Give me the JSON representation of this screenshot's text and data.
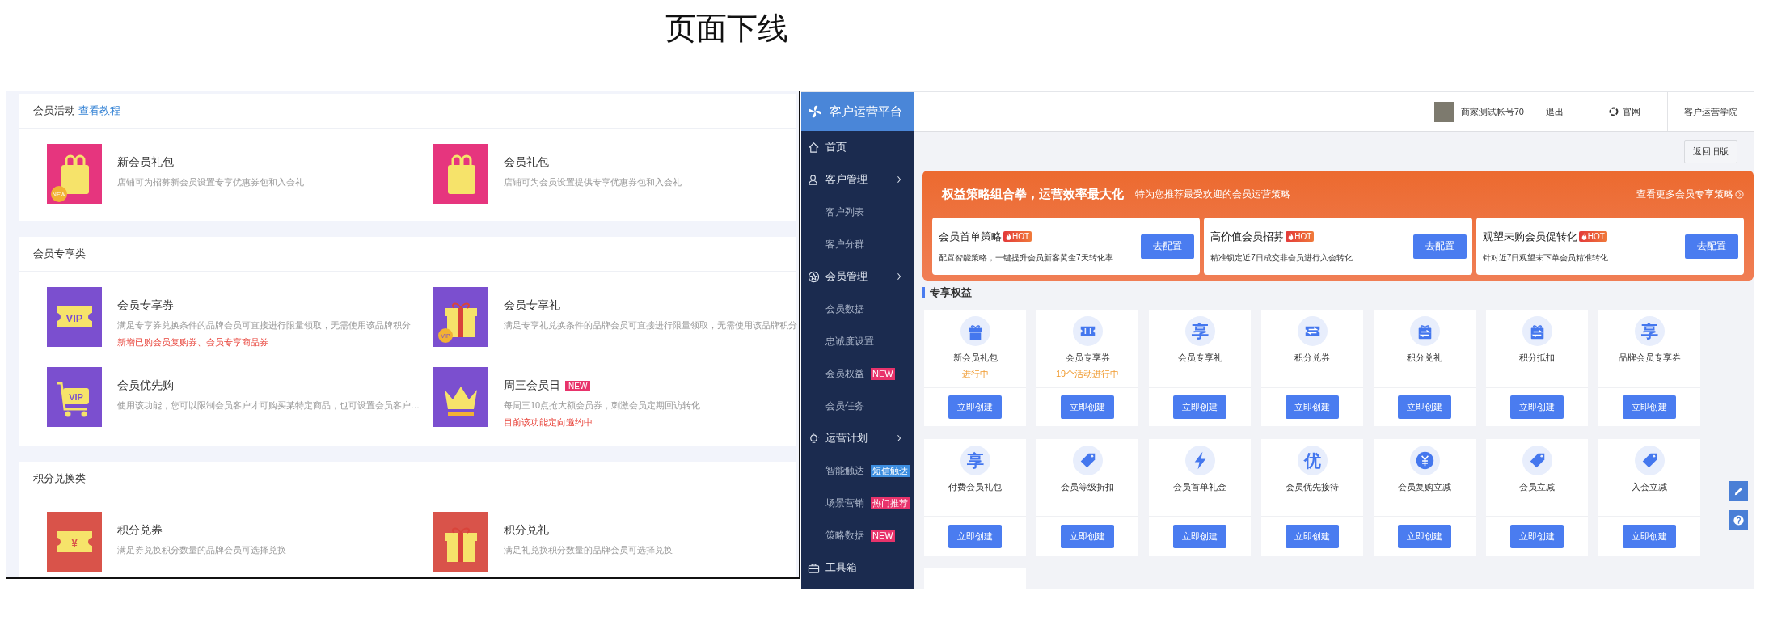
{
  "page_title": "页面下线",
  "old_page": {
    "sections": [
      {
        "title": "会员活动",
        "link": "查看教程",
        "color": "#e6357e",
        "items": [
          {
            "title": "新会员礼包",
            "desc": "店铺可为招募新会员设置专享优惠券包和入会礼",
            "kind": "bag",
            "icon_text": "NEW"
          },
          {
            "title": "会员礼包",
            "desc": "店铺可为会员设置提供专享优惠券包和入会礼",
            "kind": "bag"
          }
        ]
      },
      {
        "title": "会员专享类",
        "color": "#7b4fcf",
        "items": [
          {
            "title": "会员专享券",
            "desc": "满足专享券兑换条件的品牌会员可直接进行限量领取，无需使用该品牌积分",
            "note": "新增已购会员复购券、会员专享商品券",
            "kind": "ticket",
            "icon_text": "VIP"
          },
          {
            "title": "会员专享礼",
            "desc": "满足专享礼兑换条件的品牌会员可直接进行限量领取，无需使用该品牌积分",
            "kind": "gift",
            "icon_text": "VIP"
          },
          {
            "title": "会员优先购",
            "desc": "使用该功能，您可以限制会员客户才可购买某特定商品，也可设置会员客户…",
            "kind": "cart",
            "icon_text": "VIP"
          },
          {
            "title": "周三会员日",
            "badge": "NEW",
            "desc": "每周三10点抢大额会员券，刺激会员定期回访转化",
            "note": "目前该功能定向邀约中",
            "kind": "crown"
          }
        ]
      },
      {
        "title": "积分兑换类",
        "color": "#d9534a",
        "items": [
          {
            "title": "积分兑券",
            "desc": "满足券兑换积分数量的品牌会员可选择兑换",
            "kind": "ticket",
            "icon_text": "¥"
          },
          {
            "title": "积分兑礼",
            "desc": "满足礼兑换积分数量的品牌会员可选择兑换",
            "kind": "gift"
          }
        ]
      }
    ]
  },
  "new_page": {
    "brand": "客户运营平台",
    "sidebar": [
      {
        "label": "首页",
        "kind": "home"
      },
      {
        "label": "客户管理",
        "kind": "user",
        "children": [
          {
            "label": "客户列表"
          },
          {
            "label": "客户分群"
          }
        ]
      },
      {
        "label": "会员管理",
        "kind": "star",
        "children": [
          {
            "label": "会员数据"
          },
          {
            "label": "忠诚度设置"
          },
          {
            "label": "会员权益",
            "badge": {
              "text": "NEW",
              "color": "#e8336b"
            }
          },
          {
            "label": "会员任务"
          }
        ]
      },
      {
        "label": "运营计划",
        "kind": "bulb",
        "children": [
          {
            "label": "智能触达",
            "badge": {
              "text": "短信触达",
              "color": "#3d8ee0"
            }
          },
          {
            "label": "场景营销",
            "badge": {
              "text": "热门推荐",
              "color": "#e8336b"
            }
          },
          {
            "label": "策略数据",
            "badge": {
              "text": "NEW",
              "color": "#e8336b"
            }
          }
        ]
      },
      {
        "label": "工具箱",
        "kind": "toolbox"
      }
    ],
    "header": {
      "account": "商家测试帐号70",
      "logout": "退出",
      "site": "官网",
      "academy": "客户运营学院"
    },
    "back_button": "返回旧版",
    "banner": {
      "title": "权益策略组合拳，运营效率最大化",
      "subtitle": "特为您推荐最受欢迎的会员运营策略",
      "more": "查看更多会员专享策略",
      "cards": [
        {
          "title": "会员首单策略",
          "badge": "HOT",
          "desc": "配置智能策略，一键提升会员新客黄金7天转化率",
          "button": "去配置"
        },
        {
          "title": "高价值会员招募",
          "badge": "HOT",
          "desc": "精准锁定近7日成交非会员进行入会转化",
          "button": "去配置"
        },
        {
          "title": "观望未购会员促转化",
          "badge": "HOT",
          "desc": "针对近7日观望未下单会员精准转化",
          "button": "去配置"
        }
      ]
    },
    "section_title": "专享权益",
    "benefits": [
      {
        "name": "新会员礼包",
        "status": "进行中",
        "kind": "gift",
        "button": "立即创建"
      },
      {
        "name": "会员专享券",
        "status": "19个活动进行中",
        "kind": "ticket",
        "button": "立即创建"
      },
      {
        "name": "会员专享礼",
        "kind": "glyph",
        "glyph": "享",
        "button": "立即创建"
      },
      {
        "name": "积分兑券",
        "kind": "swap-ticket",
        "button": "立即创建"
      },
      {
        "name": "积分兑礼",
        "kind": "swap-gift",
        "button": "立即创建"
      },
      {
        "name": "积分抵扣",
        "kind": "swap-gift",
        "button": "立即创建"
      },
      {
        "name": "品牌会员专享券",
        "kind": "glyph",
        "glyph": "享",
        "button": "立即创建"
      },
      {
        "name": "付费会员礼包",
        "kind": "glyph",
        "glyph": "享",
        "button": "立即创建"
      },
      {
        "name": "会员等级折扣",
        "kind": "tag",
        "button": "立即创建"
      },
      {
        "name": "会员首单礼金",
        "kind": "bolt",
        "button": "立即创建"
      },
      {
        "name": "会员优先接待",
        "kind": "glyph",
        "glyph": "优",
        "button": "立即创建"
      },
      {
        "name": "会员复购立减",
        "kind": "yen",
        "button": "立即创建"
      },
      {
        "name": "会员立减",
        "kind": "tag",
        "button": "立即创建"
      },
      {
        "name": "入会立减",
        "kind": "tag",
        "button": "立即创建"
      }
    ]
  }
}
